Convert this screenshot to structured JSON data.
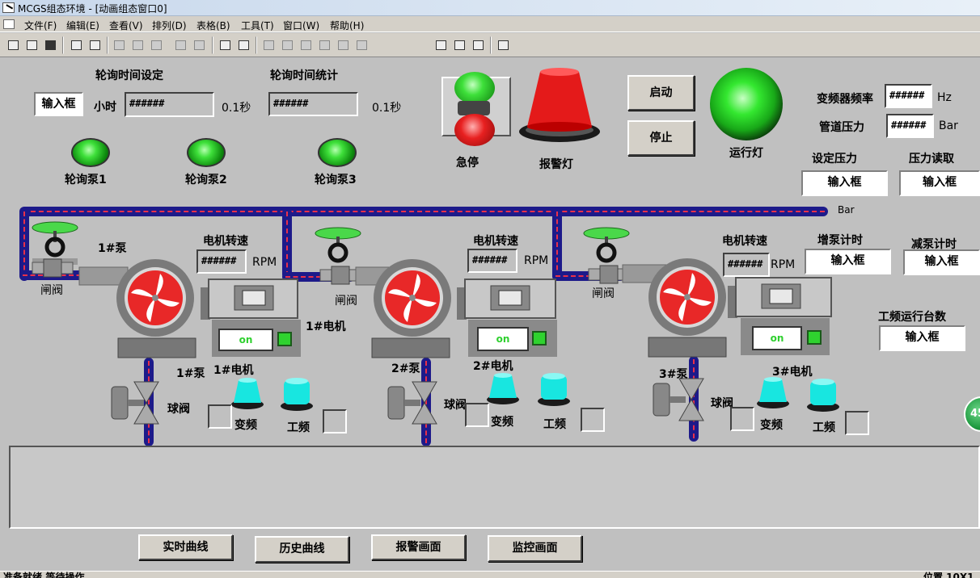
{
  "window": {
    "title": "MCGS组态环境 - [动画组态窗口0]"
  },
  "menu": [
    "文件(F)",
    "编辑(E)",
    "查看(V)",
    "排列(D)",
    "表格(B)",
    "工具(T)",
    "窗口(W)",
    "帮助(H)"
  ],
  "polling": {
    "time_setting_label": "轮询时间设定",
    "time_stat_label": "轮询时间统计",
    "input_box": "输入框",
    "hours_label": "小时",
    "setting_value": "######",
    "unit1": "0.1秒",
    "stat_value": "######",
    "unit2": "0.1秒",
    "pump_lamps": [
      "轮询泵1",
      "轮询泵2",
      "轮询泵3"
    ]
  },
  "controls": {
    "estop_label": "急停",
    "alarm_lamp_label": "报警灯",
    "start_button": "启动",
    "stop_button": "停止",
    "run_lamp_label": "运行灯"
  },
  "right_panel": {
    "vfd_freq_label": "变频器频率",
    "vfd_freq_value": "######",
    "vfd_freq_unit": "Hz",
    "pipe_pressure_label": "管道压力",
    "pipe_pressure_value": "######",
    "pipe_pressure_unit": "Bar",
    "set_pressure_label": "设定压力",
    "set_pressure_input": "输入框",
    "pressure_read_label": "压力读取",
    "pressure_read_input": "输入框",
    "bar_label": "Bar",
    "add_pump_label": "增泵计时",
    "add_pump_input": "输入框",
    "reduce_pump_label": "减泵计时",
    "reduce_pump_input": "输入框",
    "power_freq_count_label": "工频运行台数",
    "power_freq_count_input": "输入框",
    "badge": "45"
  },
  "units": [
    {
      "pump": "1#泵",
      "valve": "闸阀",
      "motor_speed_label": "电机转速",
      "speed_value": "######",
      "speed_unit": "RPM",
      "motor_label": "1#电机",
      "motor_status": "on",
      "pump_bottom": "1#泵",
      "motor_bottom": "1#电机",
      "ball_valve": "球阀",
      "vfd": "变频",
      "pf": "工频"
    },
    {
      "pump": "2#泵",
      "valve": "闸阀",
      "motor_speed_label": "电机转速",
      "speed_value": "######",
      "speed_unit": "RPM",
      "motor_label": "2#电机",
      "motor_status": "on",
      "pump_bottom": "2#泵",
      "motor_bottom": "2#电机",
      "ball_valve": "球阀",
      "vfd": "变频",
      "pf": "工频"
    },
    {
      "pump": "3#泵",
      "valve": "闸阀",
      "motor_speed_label": "电机转速",
      "speed_value": "######",
      "speed_unit": "RPM",
      "motor_label": "3#电机",
      "motor_status": "on",
      "pump_bottom": "3#泵",
      "motor_bottom": "3#电机",
      "ball_valve": "球阀",
      "vfd": "变频",
      "pf": "工频"
    }
  ],
  "nav_buttons": [
    "实时曲线",
    "历史曲线",
    "报警画面",
    "监控画面"
  ],
  "status": {
    "left": "准备就绪,等待操作",
    "right": "位置 10X1"
  }
}
